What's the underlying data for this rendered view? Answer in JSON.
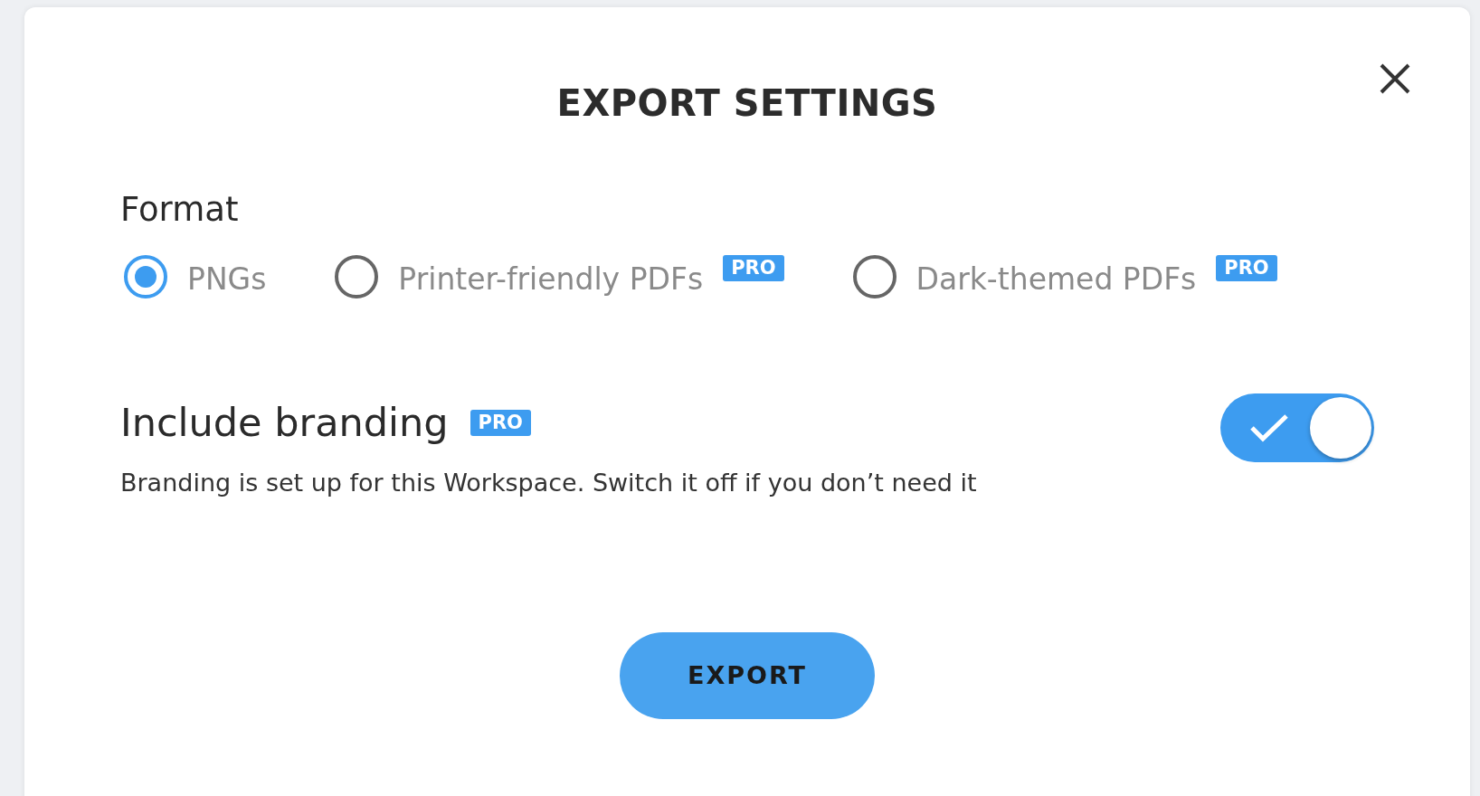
{
  "dialog": {
    "title": "EXPORT SETTINGS"
  },
  "format": {
    "label": "Format",
    "options": [
      {
        "label": "PNGs",
        "selected": true
      },
      {
        "label": "Printer-friendly PDFs",
        "selected": false,
        "badge": "PRO"
      },
      {
        "label": "Dark-themed PDFs",
        "selected": false,
        "badge": "PRO"
      }
    ]
  },
  "branding": {
    "label": "Include branding",
    "badge": "PRO",
    "description": "Branding is set up for this Workspace. Switch it off if you don’t need it",
    "on": true
  },
  "export_button": "EXPORT"
}
